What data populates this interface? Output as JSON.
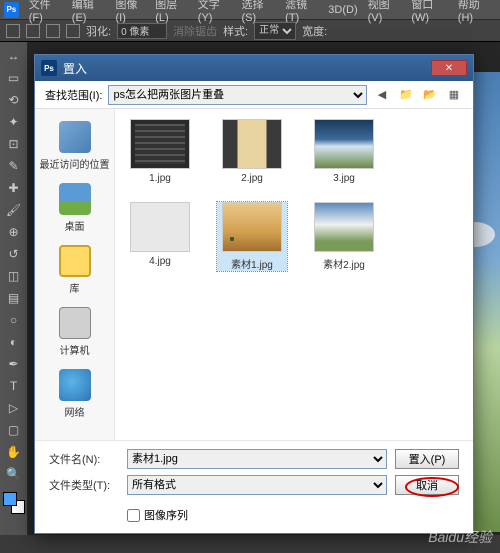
{
  "menubar": {
    "items": [
      "文件(F)",
      "编辑(E)",
      "图像(I)",
      "图层(L)",
      "文字(Y)",
      "选择(S)",
      "滤镜(T)",
      "3D(D)",
      "视图(V)",
      "窗口(W)",
      "帮助(H)"
    ]
  },
  "optionsbar": {
    "feather_label": "羽化:",
    "feather_value": "0 像素",
    "antialias": "消除锯齿",
    "style_label": "样式:",
    "style_value": "正常",
    "width_label": "宽度:"
  },
  "dialog": {
    "title": "置入",
    "lookin_label": "查找范围(I):",
    "lookin_value": "ps怎么把两张图片重叠",
    "places": [
      {
        "label": "最近访问的位置",
        "cls": "recent"
      },
      {
        "label": "桌面",
        "cls": "desktop"
      },
      {
        "label": "库",
        "cls": "lib"
      },
      {
        "label": "计算机",
        "cls": "computer"
      },
      {
        "label": "网络",
        "cls": "network"
      }
    ],
    "files": [
      {
        "name": "1.jpg",
        "cls": "app",
        "selected": false
      },
      {
        "name": "2.jpg",
        "cls": "panel",
        "selected": false
      },
      {
        "name": "3.jpg",
        "cls": "sky",
        "selected": false
      },
      {
        "name": "4.jpg",
        "cls": "settings",
        "selected": false
      },
      {
        "name": "素材1.jpg",
        "cls": "desert",
        "selected": true
      },
      {
        "name": "素材2.jpg",
        "cls": "mtn",
        "selected": false
      }
    ],
    "filename_label": "文件名(N):",
    "filename_value": "素材1.jpg",
    "filetype_label": "文件类型(T):",
    "filetype_value": "所有格式",
    "place_btn": "置入(P)",
    "cancel_btn": "取消",
    "sequence_label": "图像序列"
  },
  "watermark": "Baidu经验"
}
